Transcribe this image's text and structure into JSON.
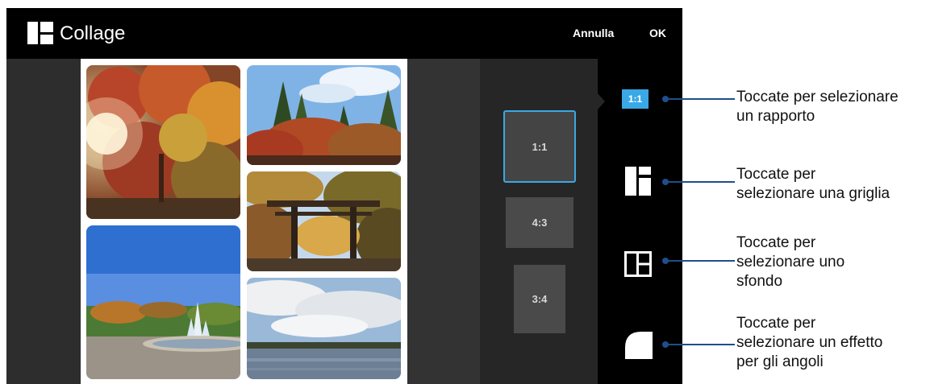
{
  "app": {
    "title": "Collage",
    "cancel_label": "Annulla",
    "ok_label": "OK"
  },
  "ratio_options": [
    {
      "label": "1:1",
      "selected": true
    },
    {
      "label": "4:3",
      "selected": false
    },
    {
      "label": "3:4",
      "selected": false
    }
  ],
  "toolbar": {
    "ratio_badge_label": "1:1",
    "tools": [
      "ratio-icon",
      "grid-layout-icon",
      "background-frame-icon",
      "corner-effect-icon"
    ]
  },
  "photos": [
    "autumn-tree-sunlight-photo",
    "temple-trees-sky-photo",
    "torii-gate-photo",
    "fountain-park-photo",
    "river-clouds-photo"
  ],
  "callouts": [
    {
      "lines": [
        "Toccate per selezionare",
        "un rapporto"
      ]
    },
    {
      "lines": [
        "Toccate per",
        "selezionare una griglia"
      ]
    },
    {
      "lines": [
        "Toccate per",
        "selezionare uno",
        "sfondo"
      ]
    },
    {
      "lines": [
        "Toccate per",
        "selezionare un effetto",
        "per gli angoli"
      ]
    }
  ],
  "colors": {
    "accent": "#3aa8e6",
    "callout_line": "#1f4e8c",
    "topbar": "#000000"
  }
}
